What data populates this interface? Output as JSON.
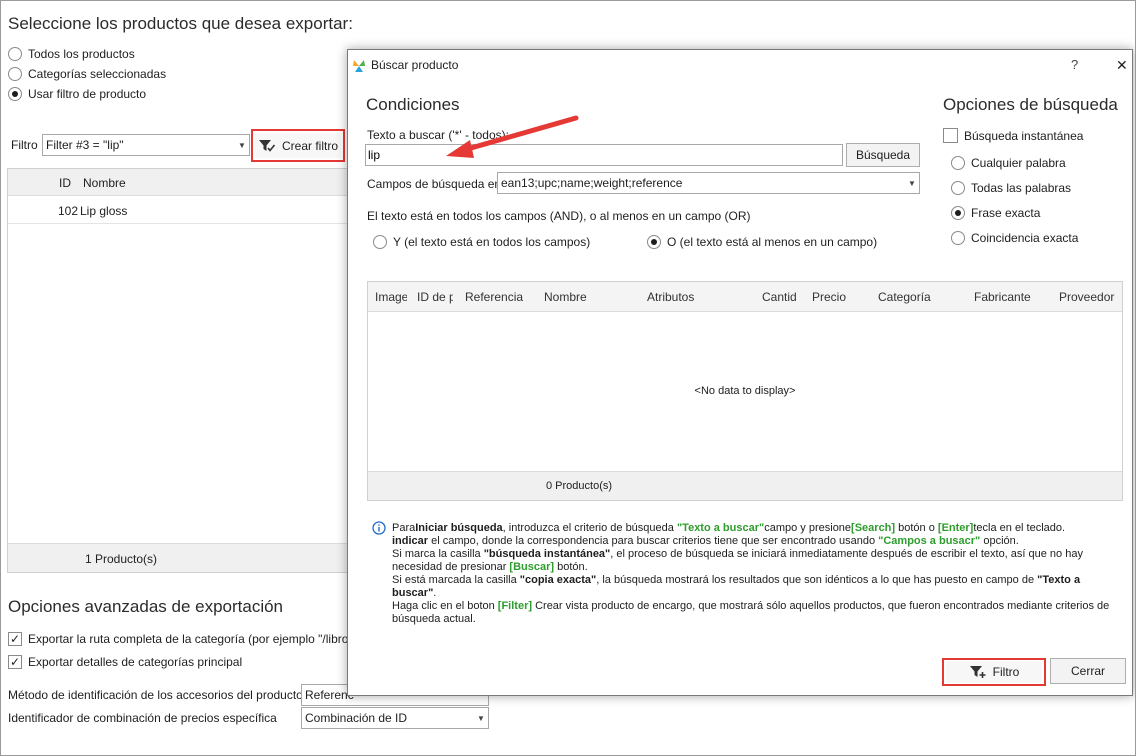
{
  "background": {
    "title": "Seleccione los productos que desea exportar:",
    "radios": [
      {
        "label": "Todos los productos",
        "checked": false
      },
      {
        "label": "Categorías seleccionadas",
        "checked": false
      },
      {
        "label": "Usar filtro de producto",
        "checked": true
      }
    ],
    "filter_label": "Filtro",
    "filter_value": "Filter #3 = \"lip\"",
    "create_filter_button": "Crear filtro",
    "grid": {
      "columns": [
        "ID",
        "Nombre"
      ],
      "rows": [
        {
          "id": "102",
          "name": "Lip gloss"
        }
      ],
      "footer": "1 Producto(s)"
    },
    "advanced_title": "Opciones avanzadas de exportación",
    "checkboxes": [
      {
        "label": "Exportar la ruta completa de la categoría (por ejemplo \"/libros/inter",
        "checked": true
      },
      {
        "label": "Exportar detalles de categorías principal",
        "checked": true
      }
    ],
    "accessories_label": "Método de identificación de los accesorios del producto",
    "accessories_value": "Referenc",
    "combination_label": "Identificador de combinación de precios específica",
    "combination_value": "Combinación de ID"
  },
  "dialog": {
    "title": "Búscar producto",
    "help": "?",
    "close": "✕",
    "conditions_title": "Condiciones",
    "search_text_label": "Texto a buscar ('*' - todos):",
    "search_text_value": "lip",
    "search_button": "Búsqueda",
    "fields_label": "Campos de búsqueda en",
    "fields_value": "ean13;upc;name;weight;reference",
    "and_or_label": "El texto está en todos los campos (AND), o al menos en un campo (OR)",
    "and_option": "Y (el texto está en todos los campos)",
    "or_option": "O (el texto está al menos en un campo)",
    "search_options_title": "Opciones de búsqueda",
    "instant_search": "Búsqueda instantánea",
    "match_options": [
      {
        "label": "Cualquier palabra",
        "checked": false
      },
      {
        "label": "Todas las palabras",
        "checked": false
      },
      {
        "label": "Frase exacta",
        "checked": true
      },
      {
        "label": "Coincidencia exacta",
        "checked": false
      }
    ],
    "grid": {
      "columns": [
        "Image",
        "ID de p",
        "Referencia",
        "Nombre",
        "Atributos",
        "Cantid",
        "Precio",
        "Categoría",
        "Fabricante",
        "Proveedor"
      ],
      "empty": "<No data to display>",
      "footer": "0 Producto(s)"
    },
    "info": {
      "p1_a": "Para",
      "p1_b": "Iniciar búsqueda",
      "p1_c": ", introduzca el criterio de búsqueda ",
      "p1_d": "\"Texto a buscar\"",
      "p1_e": "campo y presione",
      "p1_f": "[Search]",
      "p1_g": " botón o ",
      "p1_h": "[Enter]",
      "p1_i": "tecla en el teclado.",
      "p2_a": "indicar",
      "p2_b": " el campo, donde la correspondencia para buscar criterios tiene que ser encontrado usando ",
      "p2_c": "\"Campos a busacr\"",
      "p2_d": " opción.",
      "p3_a": "Si marca la casilla ",
      "p3_b": "\"búsqueda instantánea\"",
      "p3_c": ", el proceso de búsqueda se iniciará inmediatamente después de escribir el texto, así que no hay necesidad de presionar ",
      "p3_d": "[Buscar]",
      "p3_e": " botón.",
      "p4_a": "Si está marcada la casilla ",
      "p4_b": "\"copia exacta\"",
      "p4_c": ", la búsqueda mostrará los resultados que son idénticos a lo que has puesto en campo de ",
      "p4_d": "\"Texto a buscar\"",
      "p4_e": ".",
      "p5_a": "Haga clic en el boton ",
      "p5_b": "[Filter]",
      "p5_c": " Crear vista producto de encargo, que mostrará sólo aquellos productos, que fueron encontrados mediante criterios de búsqueda actual."
    },
    "filter_button": "Filtro",
    "close_button": "Cerrar"
  },
  "colors": {
    "highlight": "#e53935",
    "info_green": "#2e9d2e",
    "info_icon": "#1e6fc8"
  }
}
